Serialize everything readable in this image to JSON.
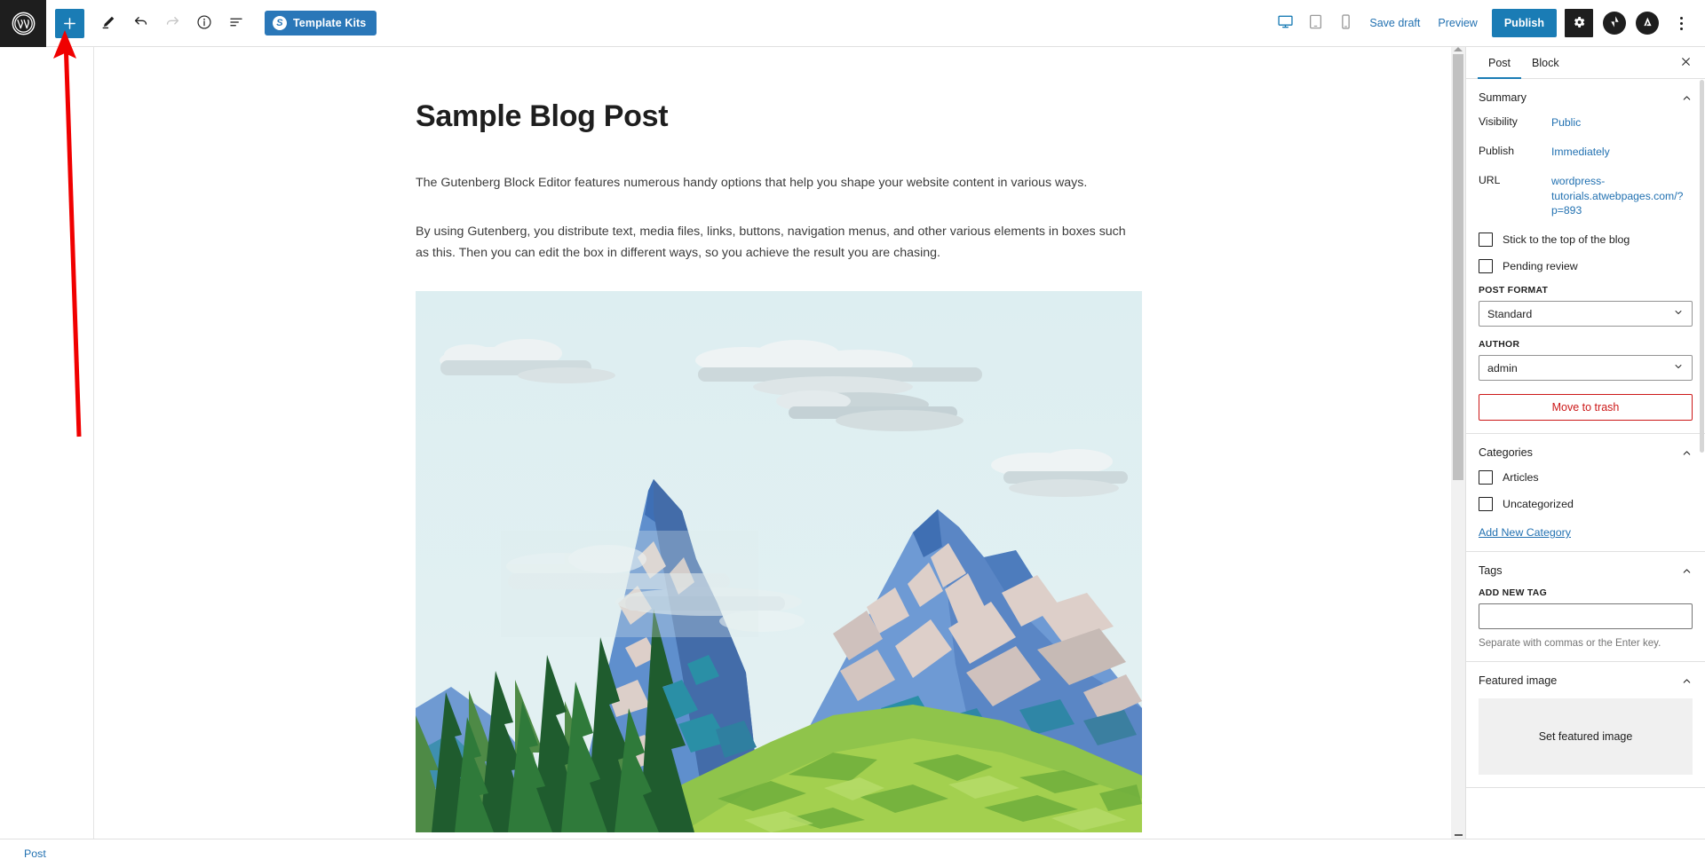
{
  "app": {
    "name": "WordPress Block Editor",
    "logo_icon": "wordpress-logo-icon"
  },
  "toolbar": {
    "add_block_label": "+",
    "add_block_icon": "plus-icon",
    "tools_icon": "pencil-icon",
    "undo_icon": "undo-arrow-icon",
    "redo_icon": "redo-arrow-icon",
    "details_icon": "info-circle-icon",
    "list_view_icon": "list-view-icon",
    "template_kits_label": "Template Kits",
    "template_kits_badge": "S"
  },
  "view_modes": [
    {
      "name": "desktop",
      "icon": "desktop-monitor-icon",
      "active": true
    },
    {
      "name": "tablet",
      "icon": "tablet-icon",
      "active": false
    },
    {
      "name": "mobile",
      "icon": "mobile-phone-icon",
      "active": false
    }
  ],
  "actions": {
    "save_draft_label": "Save draft",
    "preview_label": "Preview",
    "publish_label": "Publish",
    "settings_icon": "gear-icon",
    "jetpack_icon": "jetpack-icon",
    "astra_icon": "astra-logo-icon",
    "more_options_icon": "kebab-menu-icon"
  },
  "post": {
    "title": "Sample Blog Post",
    "paragraphs": [
      "The Gutenberg Block Editor features numerous handy options that help you shape your website content in various ways.",
      "By using Gutenberg, you distribute text, media files, links, buttons, navigation menus, and other various elements in boxes such as this. Then you can edit the box in different ways, so you achieve the result you are chasing."
    ],
    "image_alt": "Illustration of mountains with pine trees, green hills and clouds"
  },
  "sidebar": {
    "tabs": [
      {
        "label": "Post",
        "active": true
      },
      {
        "label": "Block",
        "active": false
      }
    ],
    "close_icon": "close-icon",
    "summary": {
      "title": "Summary",
      "collapse_icon": "chevron-up-icon",
      "rows": [
        {
          "key": "Visibility",
          "value": "Public"
        },
        {
          "key": "Publish",
          "value": "Immediately"
        },
        {
          "key": "URL",
          "value": "wordpress-tutorials.atwebpages.com/?p=893"
        }
      ],
      "checkboxes": [
        {
          "label": "Stick to the top of the blog",
          "checked": false
        },
        {
          "label": "Pending review",
          "checked": false
        }
      ],
      "post_format_label": "POST FORMAT",
      "post_format_value": "Standard",
      "author_label": "AUTHOR",
      "author_value": "admin",
      "trash_label": "Move to trash"
    },
    "categories": {
      "title": "Categories",
      "collapse_icon": "chevron-up-icon",
      "items": [
        {
          "label": "Articles",
          "checked": false
        },
        {
          "label": "Uncategorized",
          "checked": false
        }
      ],
      "add_link": "Add New Category"
    },
    "tags": {
      "title": "Tags",
      "collapse_icon": "chevron-up-icon",
      "field_label": "ADD NEW TAG",
      "field_value": "",
      "help": "Separate with commas or the Enter key."
    },
    "featured_image": {
      "title": "Featured image",
      "collapse_icon": "chevron-up-icon",
      "set_label": "Set featured image"
    }
  },
  "footer": {
    "breadcrumb": "Post"
  },
  "annotation": {
    "type": "arrow",
    "color": "#f00000",
    "points_to": "add-block-button"
  },
  "colors": {
    "accent_blue": "#1a7cb5",
    "link_blue": "#2271b1",
    "danger_red": "#cc1818",
    "dark": "#1e1e1e",
    "annotation_red": "#f00000"
  }
}
